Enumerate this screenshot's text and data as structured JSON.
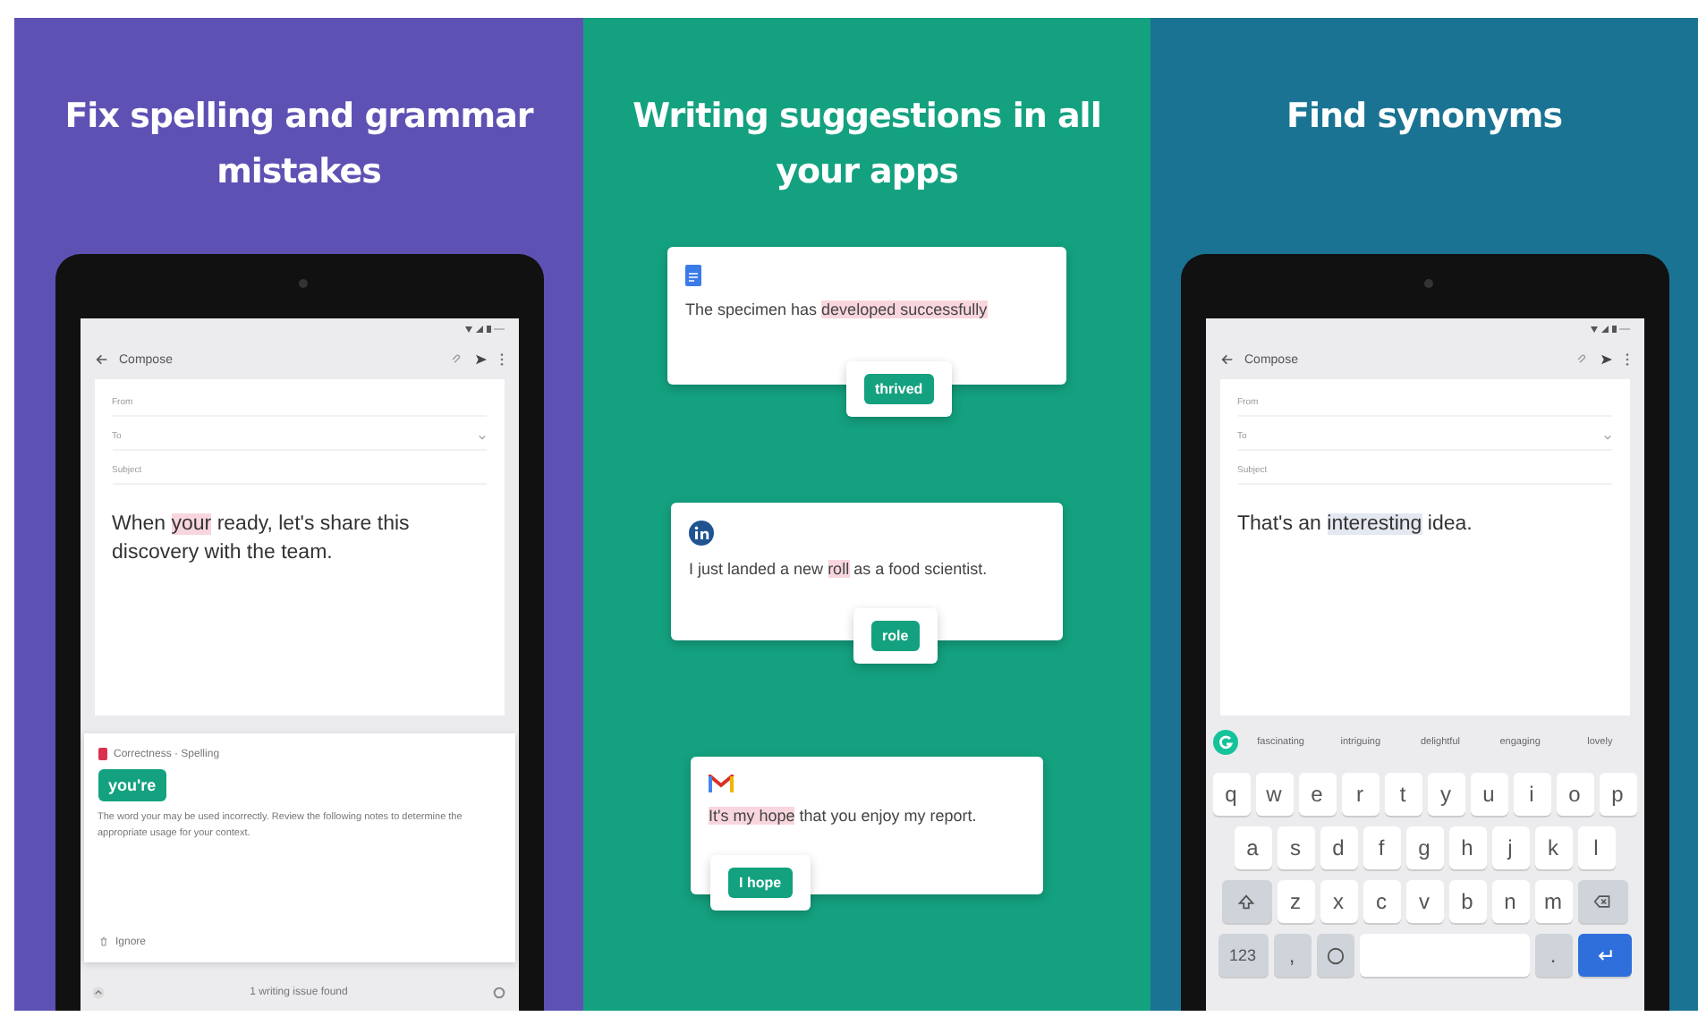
{
  "panels": [
    {
      "kind": "correction",
      "color": "#5d52b4",
      "title": "Fix spelling and grammar mistakes",
      "screen": {
        "app_title": "Compose",
        "fields": [
          "From",
          "To",
          "Subject"
        ],
        "body": {
          "before": "When ",
          "highlight": "your",
          "after": " ready, let's share this discovery with the team."
        },
        "card": {
          "category": "Correctness · Spelling",
          "suggestion": "you're",
          "explanation": "The word your may be used incorrectly. Review the following notes to determine the appropriate usage for your context.",
          "action": "Ignore"
        },
        "footer": "1 writing issue found"
      }
    },
    {
      "kind": "cards",
      "color": "#14a17f",
      "title": "Writing suggestions in all your apps",
      "cards": [
        {
          "kind": "docs",
          "before": "The specimen has ",
          "highlight": "developed successfully",
          "suggestion": "thrived"
        },
        {
          "kind": "linkedin",
          "before": "I just landed a new ",
          "highlight": "roll",
          "after": " as a food scientist.",
          "suggestion": "role"
        },
        {
          "kind": "gmail",
          "highlight": "It's my hope",
          "after": " that you enjoy my report.",
          "suggestion": "I hope"
        }
      ]
    },
    {
      "kind": "keyboard",
      "color": "#1a7393",
      "title": "Find synonyms",
      "screen": {
        "app_title": "Compose",
        "fields": [
          "From",
          "To",
          "Subject"
        ],
        "body": {
          "before": "That's an ",
          "highlight": "interesting",
          "after": " idea."
        },
        "synonyms": [
          "fascinating",
          "intriguing",
          "delightful",
          "engaging",
          "lovely"
        ],
        "keys": [
          [
            "q",
            "w",
            "e",
            "r",
            "t",
            "y",
            "u",
            "i",
            "o",
            "p"
          ],
          [
            "a",
            "s",
            "d",
            "f",
            "g",
            "h",
            "j",
            "k",
            "l"
          ],
          [
            "z",
            "x",
            "c",
            "v",
            "b",
            "n",
            "m"
          ]
        ],
        "mode_key": "123",
        "comma_key": ",",
        "period_key": "."
      }
    }
  ]
}
